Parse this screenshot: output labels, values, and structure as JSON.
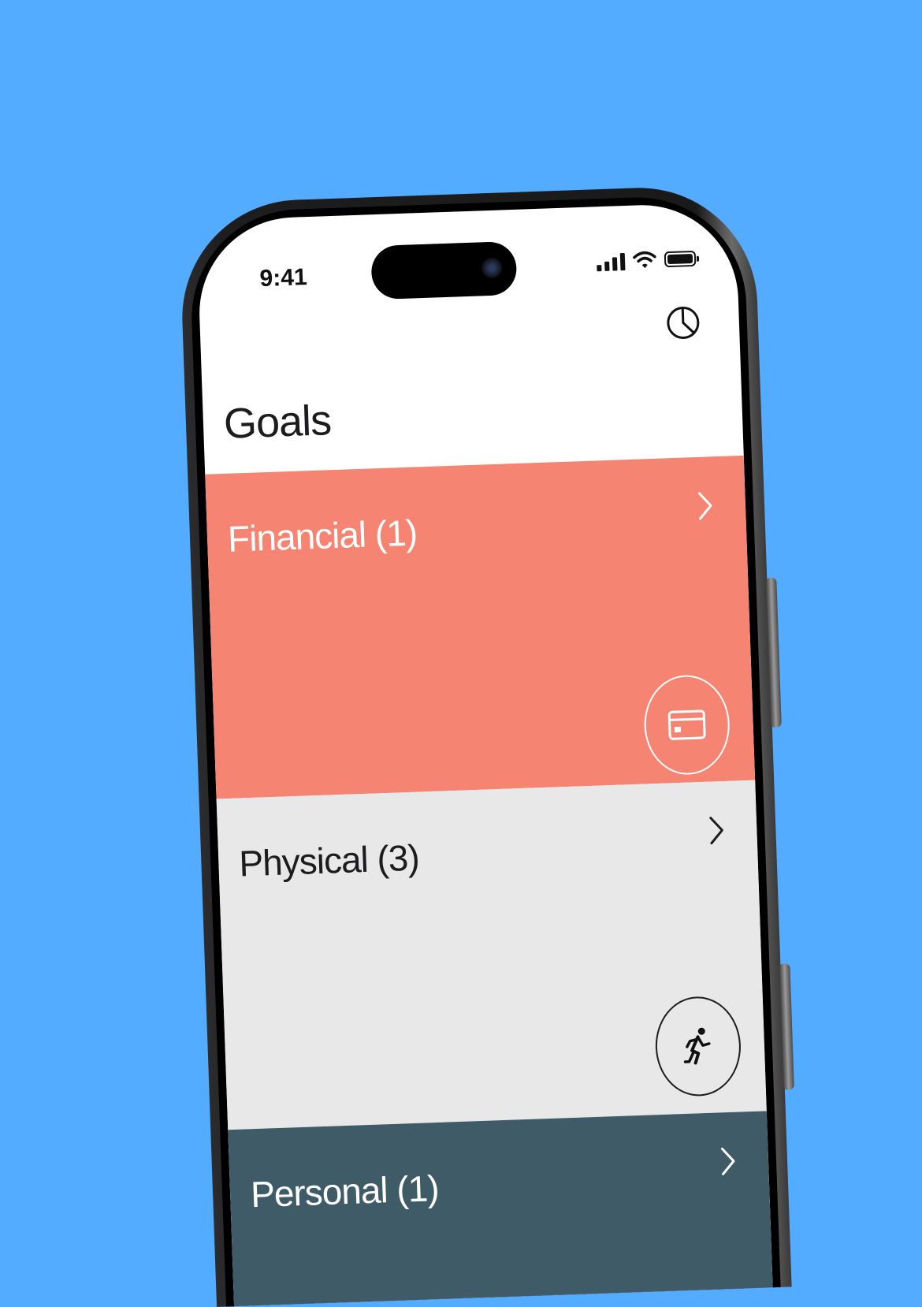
{
  "status_bar": {
    "time": "9:41"
  },
  "header": {
    "title": "Goals",
    "stats_icon": "pie-chart-icon"
  },
  "goals": [
    {
      "label": "Financial (1)",
      "icon": "credit-card-icon",
      "color": "#f68473",
      "text_color": "#ffffff"
    },
    {
      "label": "Physical (3)",
      "icon": "running-figure-icon",
      "color": "#e8e8e9",
      "text_color": "#1c1c1e"
    },
    {
      "label": "Personal (1)",
      "icon": "",
      "color": "#3f5b67",
      "text_color": "#ffffff"
    }
  ],
  "colors": {
    "background": "#53acff",
    "phone_frame": "#1d1d1f"
  }
}
